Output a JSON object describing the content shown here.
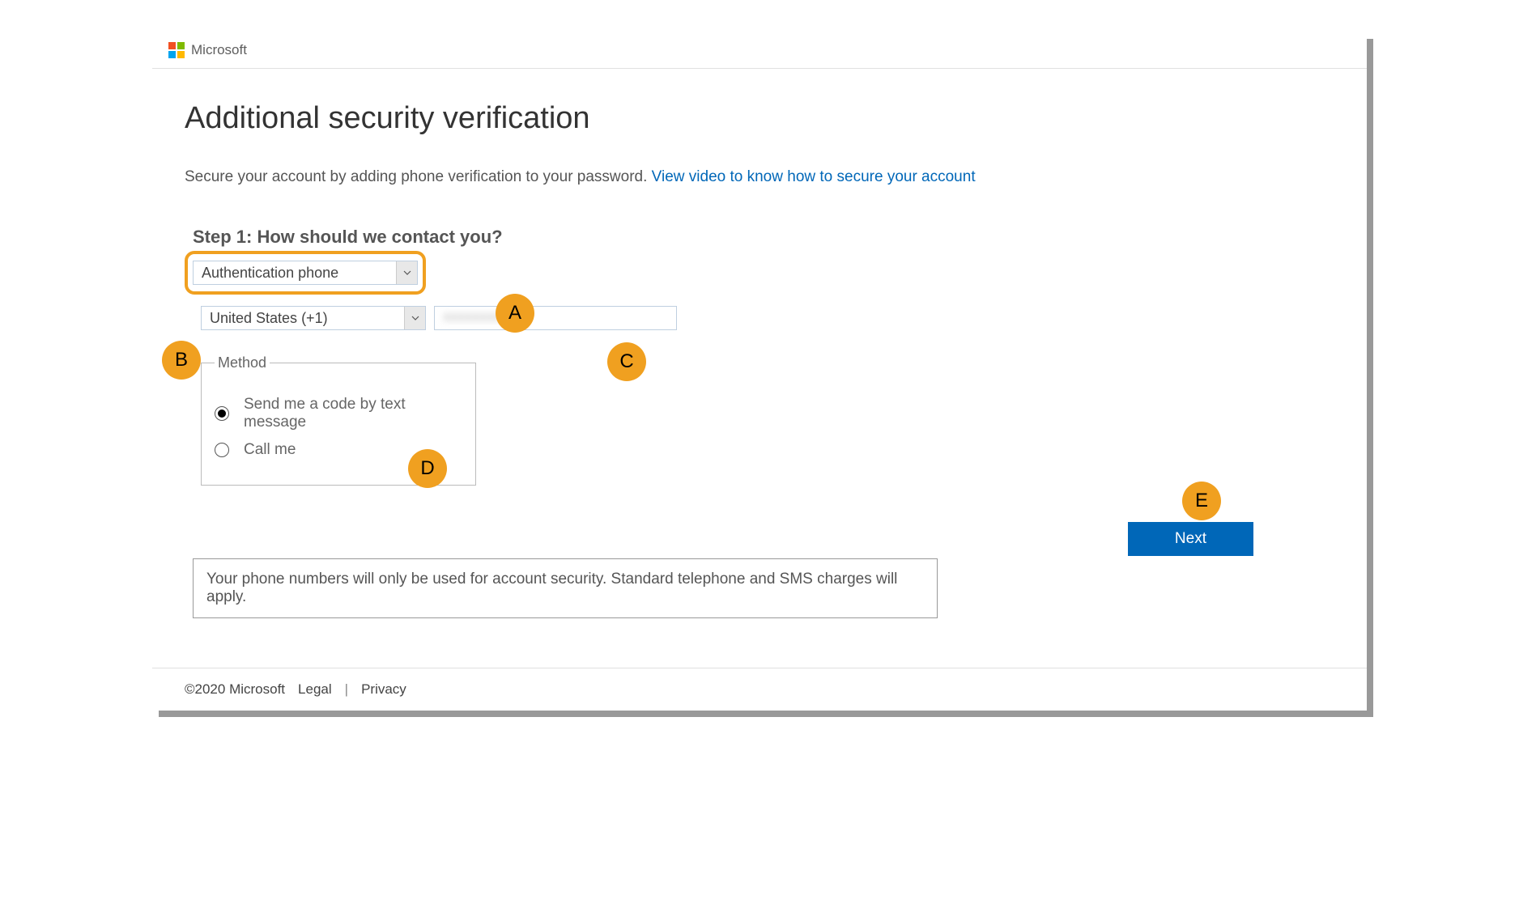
{
  "header": {
    "brand": "Microsoft"
  },
  "page": {
    "title": "Additional security verification",
    "subtitle_prefix": "Secure your account by adding phone verification to your password. ",
    "subtitle_link": "View video to know how to secure your account"
  },
  "step": {
    "heading": "Step 1: How should we contact you?",
    "contact_method": "Authentication phone",
    "country": "United States (+1)",
    "phone_value": "xxxxxxxxxx"
  },
  "method": {
    "legend": "Method",
    "option_text": "Send me a code by text message",
    "option_call": "Call me"
  },
  "buttons": {
    "next": "Next"
  },
  "notice": "Your phone numbers will only be used for account security. Standard telephone and SMS charges will apply.",
  "footer": {
    "copyright": "©2020 Microsoft",
    "legal": "Legal",
    "privacy": "Privacy"
  },
  "callouts": {
    "A": "A",
    "B": "B",
    "C": "C",
    "D": "D",
    "E": "E"
  }
}
